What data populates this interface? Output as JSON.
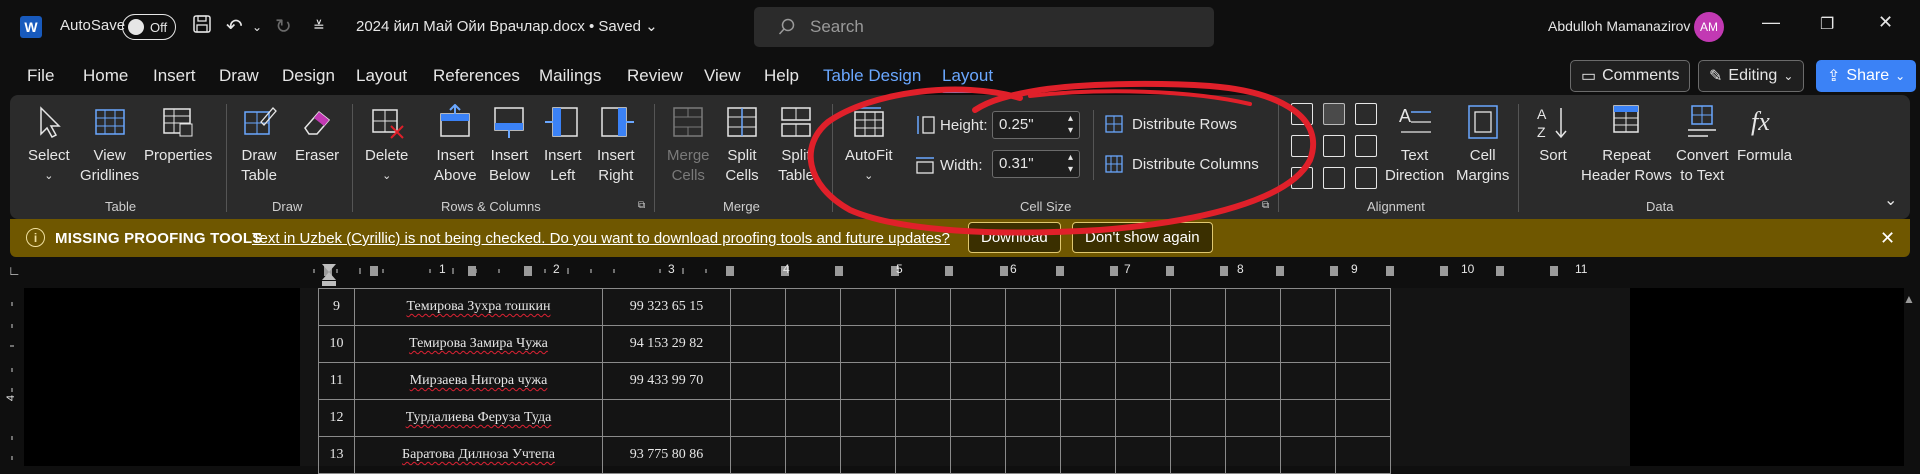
{
  "titlebar": {
    "app_letter": "W",
    "autosave_label": "AutoSave",
    "autosave_state": "Off",
    "doc_title": "2024 йил Май Ойи Врачлар.docx • Saved",
    "search_placeholder": "Search",
    "user_name": "Abdulloh Mamanazirov",
    "avatar_initials": "AM"
  },
  "tabs": [
    "File",
    "Home",
    "Insert",
    "Draw",
    "Design",
    "Layout",
    "References",
    "Mailings",
    "Review",
    "View",
    "Help",
    "Table Design",
    "Layout"
  ],
  "tab_right": {
    "comments": "Comments",
    "editing": "Editing",
    "share": "Share"
  },
  "ribbon": {
    "table": {
      "select": "Select",
      "view_gridlines_1": "View",
      "view_gridlines_2": "Gridlines",
      "properties": "Properties",
      "label": "Table"
    },
    "draw": {
      "draw_table_1": "Draw",
      "draw_table_2": "Table",
      "eraser": "Eraser",
      "label": "Draw"
    },
    "rows_cols": {
      "delete": "Delete",
      "insert_above_1": "Insert",
      "insert_above_2": "Above",
      "insert_below_1": "Insert",
      "insert_below_2": "Below",
      "insert_left_1": "Insert",
      "insert_left_2": "Left",
      "insert_right_1": "Insert",
      "insert_right_2": "Right",
      "label": "Rows & Columns"
    },
    "merge": {
      "merge_cells_1": "Merge",
      "merge_cells_2": "Cells",
      "split_cells_1": "Split",
      "split_cells_2": "Cells",
      "split_table_1": "Split",
      "split_table_2": "Table",
      "label": "Merge"
    },
    "cell_size": {
      "autofit": "AutoFit",
      "height_label": "Height:",
      "height_value": "0.25\"",
      "width_label": "Width:",
      "width_value": "0.31\"",
      "distribute_rows": "Distribute Rows",
      "distribute_columns": "Distribute Columns",
      "label": "Cell Size"
    },
    "alignment": {
      "text_direction_1": "Text",
      "text_direction_2": "Direction",
      "cell_margins_1": "Cell",
      "cell_margins_2": "Margins",
      "label": "Alignment"
    },
    "data": {
      "sort": "Sort",
      "repeat_header_1": "Repeat",
      "repeat_header_2": "Header Rows",
      "convert_1": "Convert",
      "convert_2": "to Text",
      "formula": "Formula",
      "label": "Data"
    }
  },
  "message_bar": {
    "title": "MISSING PROOFING TOOLS",
    "text": "Text in Uzbek (Cyrillic) is not being checked. Do you want to download proofing tools and future updates?",
    "download": "Download",
    "dont_show": "Don't show again"
  },
  "ruler": {
    "numbers": [
      "1",
      "2",
      "3",
      "4",
      "5",
      "6",
      "7",
      "8",
      "9",
      "10",
      "11"
    ],
    "vertical_number": "4"
  },
  "table_rows": [
    {
      "num": "9",
      "name": "Темирова Зухра тошкин",
      "phone": "99 323 65 15"
    },
    {
      "num": "10",
      "name": "Темирова Замира Чужа",
      "phone": "94 153 29 82"
    },
    {
      "num": "11",
      "name": "Мирзаева Нигора чужа",
      "phone": "99 433 99 70"
    },
    {
      "num": "12",
      "name": "Турдалиева Феруза Туда",
      "phone": ""
    },
    {
      "num": "13",
      "name": "Баратова Дилноза Учтепа",
      "phone": "93 775 80 86"
    }
  ],
  "colors": {
    "accent": "#6aa7ff",
    "share": "#3b82f6",
    "message_bar": "#6f5700",
    "annotation": "#e0202a",
    "avatar": "#c239b3"
  }
}
